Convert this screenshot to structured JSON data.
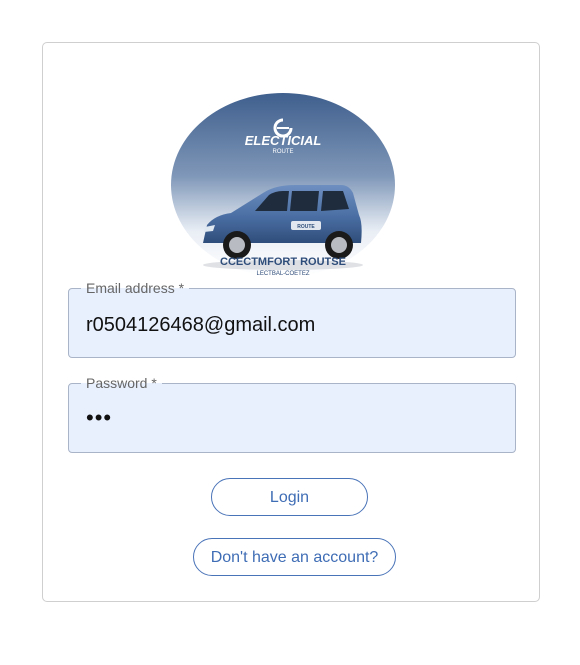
{
  "logo": {
    "brand_top": "ELECTICIAL",
    "brand_sub": "ROUTE",
    "brand_bottom": "CCECTMFORT ROUTSE",
    "brand_tag": "LECTBAL-COETEZ",
    "car_badge": "ROUTE"
  },
  "form": {
    "email": {
      "label": "Email address *",
      "value": "r0504126468@gmail.com"
    },
    "password": {
      "label": "Password *",
      "value": "•••"
    }
  },
  "buttons": {
    "login_label": "Login",
    "signup_label": "Don't have an account?"
  },
  "colors": {
    "field_bg": "#e8f0fe",
    "button_accent": "#3f6db5",
    "car_body": "#4a6ea3"
  }
}
